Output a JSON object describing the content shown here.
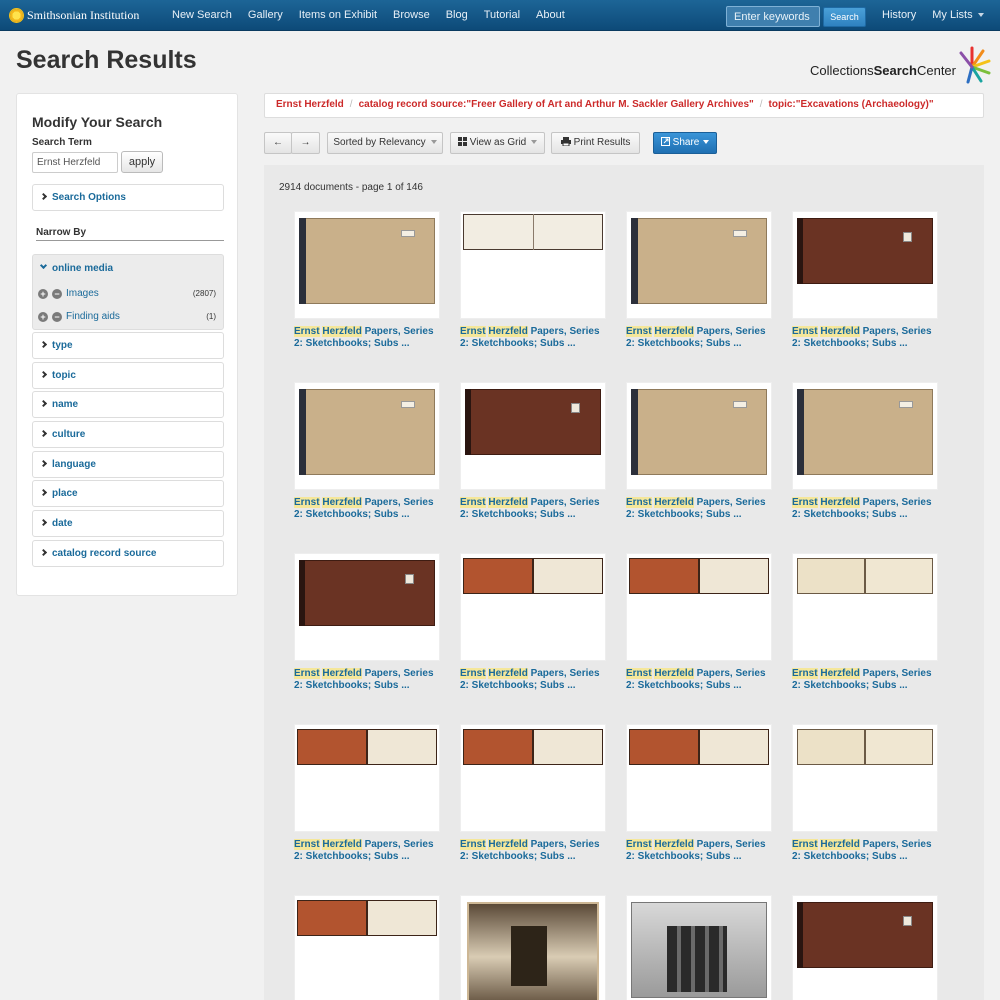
{
  "navbar": {
    "brand": "Smithsonian Institution",
    "links": [
      "New Search",
      "Gallery",
      "Items on Exhibit",
      "Browse",
      "Blog",
      "Tutorial",
      "About"
    ],
    "keywords_placeholder": "Enter keywords",
    "search_label": "Search",
    "history_label": "History",
    "my_lists_label": "My Lists"
  },
  "page_title": "Search Results",
  "logo": {
    "prefix": "Collections",
    "bold": "Search",
    "suffix": "Center"
  },
  "sidebar": {
    "title": "Modify Your Search",
    "search_term_label": "Search Term",
    "search_term_value": "Ernst Herzfeld",
    "apply_label": "apply",
    "search_options_label": "Search Options",
    "narrow_by_label": "Narrow By",
    "online_media": {
      "label": "online media",
      "items": [
        {
          "label": "Images",
          "count": "(2807)"
        },
        {
          "label": "Finding aids",
          "count": "(1)"
        }
      ]
    },
    "facets": [
      "type",
      "topic",
      "name",
      "culture",
      "language",
      "place",
      "date",
      "catalog record source"
    ]
  },
  "breadcrumbs": [
    "Ernst Herzfeld",
    "catalog record source:\"Freer Gallery of Art and Arthur M. Sackler Gallery Archives\"",
    "topic:\"Excavations (Archaeology)\""
  ],
  "toolbar": {
    "sort_label": "Sorted by Relevancy",
    "view_label": "View as Grid",
    "print_label": "Print Results",
    "share_label": "Share"
  },
  "results": {
    "count_text": "2914 documents - page 1 of 146",
    "items": [
      {
        "hl1": "Ernst",
        "hl2": "Herzfeld",
        "rest": "Papers, Series 2: Sketchbooks; Subs ...",
        "thumb": "tan-book"
      },
      {
        "hl1": "Ernst",
        "hl2": "Herzfeld",
        "rest": "Papers, Series 2: Sketchbooks; Subs ...",
        "thumb": "open-strip"
      },
      {
        "hl1": "Ernst",
        "hl2": "Herzfeld",
        "rest": "Papers, Series 2: Sketchbooks; Subs ...",
        "thumb": "tan-book"
      },
      {
        "hl1": "Ernst",
        "hl2": "Herzfeld",
        "rest": "Papers, Series 2: Sketchbooks; Subs ...",
        "thumb": "brown-book"
      },
      {
        "hl1": "Ernst",
        "hl2": "Herzfeld",
        "rest": "Papers, Series 2: Sketchbooks; Subs ...",
        "thumb": "tan-book"
      },
      {
        "hl1": "Ernst",
        "hl2": "Herzfeld",
        "rest": "Papers, Series 2: Sketchbooks; Subs ...",
        "thumb": "brown-book"
      },
      {
        "hl1": "Ernst",
        "hl2": "Herzfeld",
        "rest": "Papers, Series 2: Sketchbooks; Subs ...",
        "thumb": "tan-book"
      },
      {
        "hl1": "Ernst",
        "hl2": "Herzfeld",
        "rest": "Papers, Series 2: Sketchbooks; Subs ...",
        "thumb": "tan-book"
      },
      {
        "hl1": "Ernst",
        "hl2": "Herzfeld",
        "rest": "Papers, Series 2: Sketchbooks; Subs ...",
        "thumb": "brown-book"
      },
      {
        "hl1": "Ernst",
        "hl2": "Herzfeld",
        "rest": "Papers, Series 2: Sketchbooks; Subs ...",
        "thumb": "open-book"
      },
      {
        "hl1": "Ernst",
        "hl2": "Herzfeld",
        "rest": "Papers, Series 2: Sketchbooks; Subs ...",
        "thumb": "open-book"
      },
      {
        "hl1": "Ernst",
        "hl2": "Herzfeld",
        "rest": "Papers, Series 2: Sketchbooks; Subs ...",
        "thumb": "open-pages"
      },
      {
        "hl1": "Ernst",
        "hl2": "Herzfeld",
        "rest": "Papers, Series 2: Sketchbooks; Subs ...",
        "thumb": "open-book"
      },
      {
        "hl1": "Ernst",
        "hl2": "Herzfeld",
        "rest": "Papers, Series 2: Sketchbooks; Subs ...",
        "thumb": "open-book"
      },
      {
        "hl1": "Ernst",
        "hl2": "Herzfeld",
        "rest": "Papers, Series 2: Sketchbooks; Subs ...",
        "thumb": "open-book"
      },
      {
        "hl1": "Ernst",
        "hl2": "Herzfeld",
        "rest": "Papers, Series 2: Sketchbooks; Subs ...",
        "thumb": "open-pages"
      },
      {
        "hl1": "",
        "hl2": "",
        "rest": "",
        "thumb": "open-book"
      },
      {
        "hl1": "",
        "hl2": "",
        "rest": "",
        "thumb": "photo-interior"
      },
      {
        "hl1": "",
        "hl2": "",
        "rest": "",
        "thumb": "photo-people"
      },
      {
        "hl1": "",
        "hl2": "",
        "rest": "",
        "thumb": "brown-book"
      }
    ]
  },
  "colors": {
    "navbar": "#1d6597",
    "link": "#1a6a9a",
    "breadcrumb": "#cc2a2a",
    "highlight": "#f5e79a",
    "share_button": "#1f7dc4"
  }
}
